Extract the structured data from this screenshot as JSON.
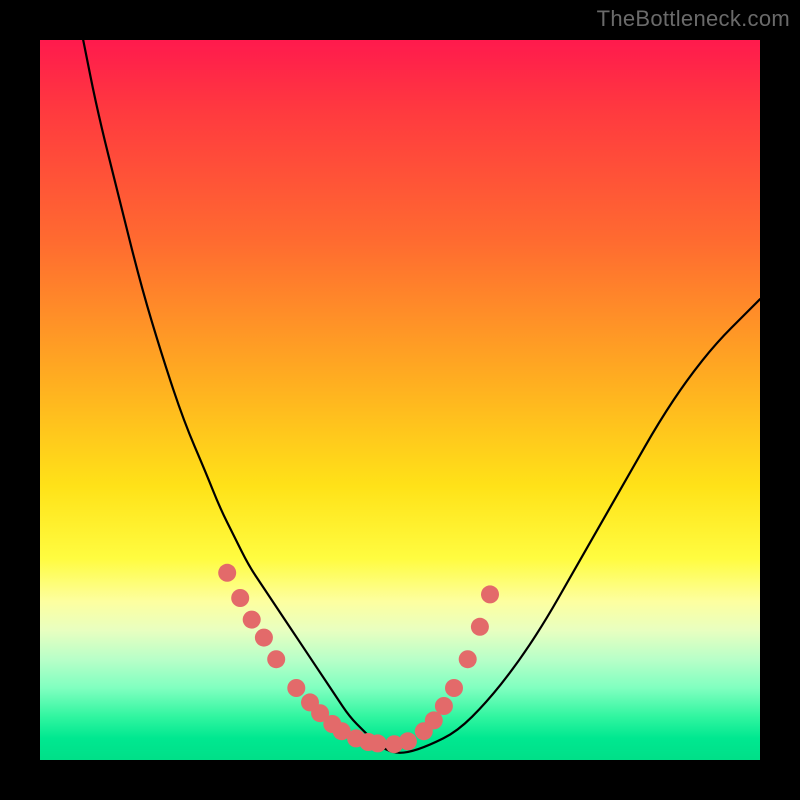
{
  "watermark": "TheBottleneck.com",
  "chart_data": {
    "type": "line",
    "title": "",
    "xlabel": "",
    "ylabel": "",
    "xlim": [
      0,
      100
    ],
    "ylim": [
      0,
      100
    ],
    "grid": false,
    "legend": false,
    "annotations": [],
    "series": [
      {
        "name": "bottleneck-curve",
        "x": [
          6,
          8,
          11,
          14,
          17,
          20,
          23,
          25,
          27,
          29,
          31,
          33,
          35,
          37,
          39,
          41,
          43,
          45,
          47,
          49,
          51,
          54,
          58,
          62,
          66,
          70,
          74,
          78,
          82,
          86,
          90,
          94,
          98,
          100
        ],
        "y": [
          100,
          90,
          78,
          66,
          56,
          47,
          40,
          35,
          31,
          27,
          24,
          21,
          18,
          15,
          12,
          9,
          6,
          4,
          2,
          1,
          1,
          2,
          4,
          8,
          13,
          19,
          26,
          33,
          40,
          47,
          53,
          58,
          62,
          64
        ]
      }
    ],
    "markers": {
      "name": "highlighted-points",
      "x_pct": [
        26.0,
        27.8,
        29.4,
        31.1,
        32.8,
        35.6,
        37.5,
        38.9,
        40.6,
        41.9,
        43.9,
        45.6,
        46.9,
        49.2,
        51.1,
        53.3,
        54.7,
        56.1,
        57.5,
        59.4,
        61.1,
        62.5
      ],
      "y_pct": [
        26.0,
        22.5,
        19.5,
        17.0,
        14.0,
        10.0,
        8.0,
        6.5,
        5.0,
        4.0,
        3.0,
        2.5,
        2.3,
        2.2,
        2.6,
        4.0,
        5.5,
        7.5,
        10.0,
        14.0,
        18.5,
        23.0
      ],
      "color": "#e36a6a",
      "radius_px": 9
    },
    "background_gradient": [
      {
        "stop": 0.0,
        "color": "#ff1a4d"
      },
      {
        "stop": 0.28,
        "color": "#ff6b30"
      },
      {
        "stop": 0.62,
        "color": "#ffe218"
      },
      {
        "stop": 0.82,
        "color": "#e8ffc0"
      },
      {
        "stop": 1.0,
        "color": "#00df88"
      }
    ]
  }
}
